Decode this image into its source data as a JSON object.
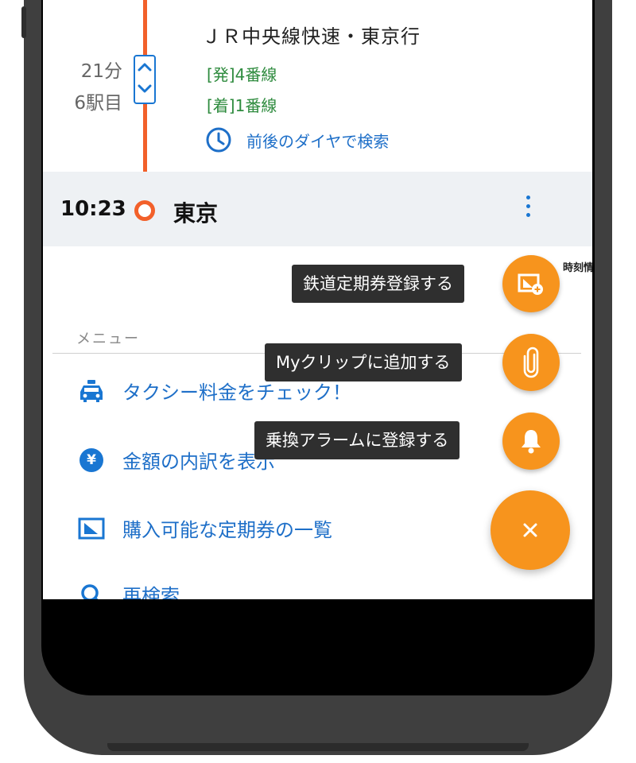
{
  "route": {
    "train_name": "ＪＲ中央線快速・東京行",
    "duration": "21分",
    "stops": "6駅目",
    "departure_platform": "[発]4番線",
    "arrival_platform": "[着]1番線",
    "timetable_search_label": "前後のダイヤで検索"
  },
  "arrival": {
    "time": "10:23",
    "station": "東京"
  },
  "timetable_peek": "時刻情報",
  "menu": {
    "header": "メニュー",
    "items": [
      {
        "label": "タクシー料金をチェック！",
        "icon": "taxi-icon"
      },
      {
        "label": "金額の内訳を表示",
        "icon": "yen-icon"
      },
      {
        "label": "購入可能な定期券の一覧",
        "icon": "commuter-pass-icon"
      },
      {
        "label": "再検索",
        "icon": "search-icon"
      }
    ]
  },
  "yen_symbol": "¥",
  "fab_actions": [
    {
      "label": "鉄道定期券登録する",
      "icon": "commuter-pass-add-icon"
    },
    {
      "label": "Myクリップに追加する",
      "icon": "paperclip-icon"
    },
    {
      "label": "乗換アラームに登録する",
      "icon": "bell-icon"
    }
  ],
  "fab_close_label": "×",
  "colors": {
    "route_line": "#f2602a",
    "accent_blue": "#1976d2",
    "platform_green": "#2e8b3e",
    "fab_orange": "#f7941d",
    "tooltip_bg": "#2f2f2f",
    "arrival_row_bg": "#eef1f4"
  }
}
